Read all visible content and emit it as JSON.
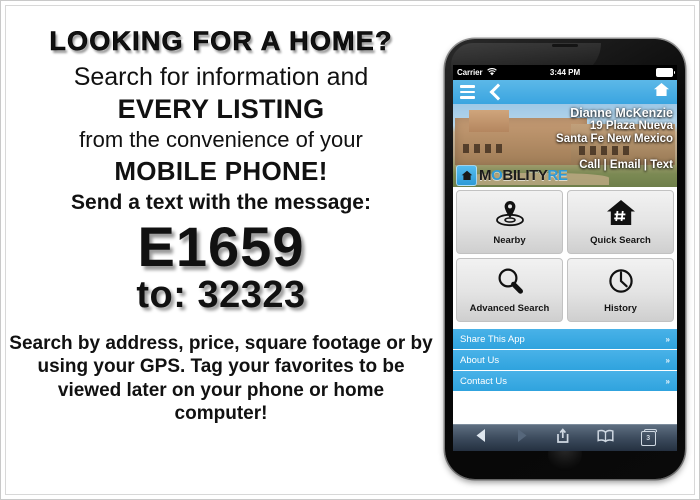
{
  "ad": {
    "headline": "LOOKING FOR A HOME?",
    "line2": "Search for information and",
    "line3": "EVERY LISTING",
    "line4": "from the convenience of your",
    "line5": "MOBILE PHONE!",
    "line6": "Send a text with the message:",
    "code": "E1659",
    "shortcode": "to: 32323",
    "footer": "Search by address, price, square footage or by using your GPS. Tag your favorites to be viewed later on your phone or home computer!"
  },
  "phone": {
    "status": {
      "carrier": "Carrier",
      "wifi_icon": "wifi-icon",
      "time": "3:44 PM",
      "battery_icon": "battery-icon"
    },
    "navbar": {
      "menu_icon": "hamburger-menu-icon",
      "back_icon": "chevron-left-icon",
      "home_icon": "home-icon",
      "color": "#3aa5e0"
    },
    "hero": {
      "agent_name": "Dianne McKenzie",
      "address_line1": "19 Plaza Nueva",
      "address_line2": "Santa Fe New Mexico",
      "contact_actions": "Call | Email | Text",
      "logo": {
        "icon": "house-logo-icon",
        "text_primary": "M",
        "text_o": "O",
        "text_rest": "BILITY",
        "text_accent": "RE",
        "accent_color": "#2e9ad6"
      }
    },
    "tiles": [
      {
        "label": "Nearby",
        "icon": "map-pin-icon"
      },
      {
        "label": "Quick Search",
        "icon": "house-hash-icon"
      },
      {
        "label": "Advanced Search",
        "icon": "magnifier-icon"
      },
      {
        "label": "History",
        "icon": "clock-icon"
      }
    ],
    "rows": [
      {
        "label": "Share This App",
        "chevron": "»"
      },
      {
        "label": "About Us",
        "chevron": "»"
      },
      {
        "label": "Contact Us",
        "chevron": "»"
      }
    ],
    "toolbar": {
      "back_icon": "triangle-back-icon",
      "forward_icon": "triangle-forward-icon",
      "share_icon": "share-icon",
      "bookmarks_icon": "book-icon",
      "tabs_icon": "tabs-icon",
      "tabs_count": "3"
    }
  }
}
